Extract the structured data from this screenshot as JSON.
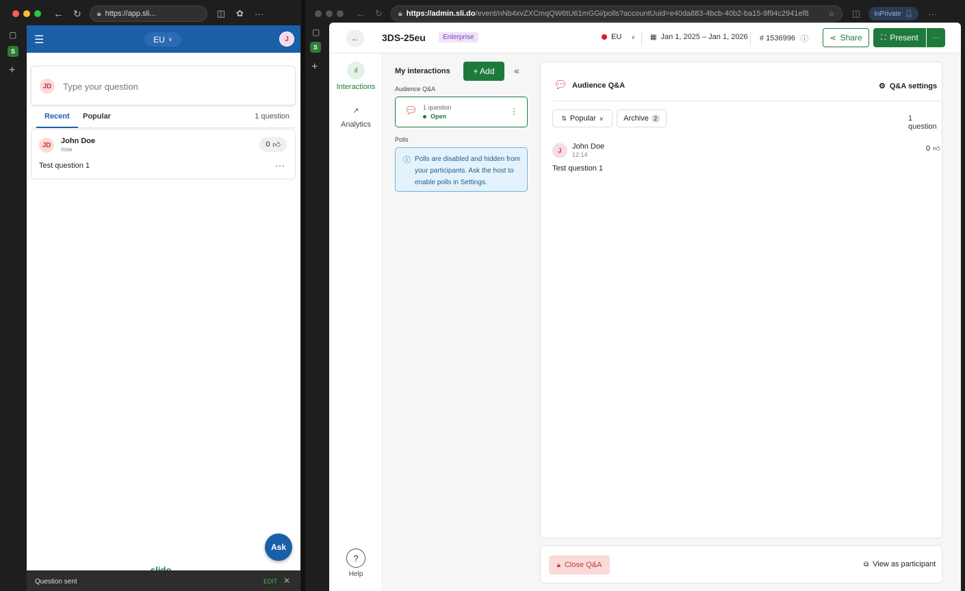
{
  "left_browser": {
    "url_host": "https://app.sli...",
    "more": "···"
  },
  "left_app": {
    "region": "EU",
    "user_initial": "J",
    "question_placeholder": "Type your question",
    "question_avatar": "JD",
    "tabs": [
      "Recent",
      "Popular"
    ],
    "count": "1 question",
    "question": {
      "avatar": "JD",
      "author": "John Doe",
      "time": "now",
      "text": "Test question 1",
      "likes": "0"
    },
    "ask_label": "Ask",
    "brand": "slido",
    "toast": {
      "text": "Question sent",
      "action": "EDIT"
    }
  },
  "right_browser": {
    "url_host": "https://admin.sli.do",
    "url_path": "/event/nNb4xvZXCmqQW6tU61mGGi/polls?accountUuid=e40da883-4bcb-40b2-ba15-9f94c2941ef8",
    "inprivate": "InPrivate",
    "more": "···"
  },
  "header": {
    "event_name": "3DS-25eu",
    "plan_badge": "Enterprise",
    "region": "EU",
    "dates": "Jan 1, 2025 – Jan 1, 2026",
    "event_code": "# 1536996",
    "share_label": "Share",
    "present_label": "Present",
    "more_label": "···"
  },
  "nav": {
    "interactions": "Interactions",
    "analytics": "Analytics",
    "help": "Help"
  },
  "interactions_panel": {
    "title": "My interactions",
    "add_label": "+ Add",
    "qa_section": "Audience Q&A",
    "qa_card": {
      "count": "1 question",
      "status": "Open"
    },
    "polls_section": "Polls",
    "polls_notice": "Polls are disabled and hidden from your participants. Ask the host to enable polls in Settings."
  },
  "qa_panel": {
    "title": "Audience Q&A",
    "settings_label": "Q&A settings",
    "sort_label": "Popular",
    "archive_label": "Archive",
    "archive_count": "2",
    "count": "1 question",
    "question": {
      "avatar": "J",
      "author": "John Doe",
      "time": "12:14",
      "text": "Test question 1",
      "likes": "0"
    },
    "close_label": "Close Q&A",
    "view_label": "View as participant"
  },
  "colors": {
    "brand_green": "#1e7a3a",
    "header_blue": "#1b5fa8",
    "live_red": "#e0191f"
  }
}
